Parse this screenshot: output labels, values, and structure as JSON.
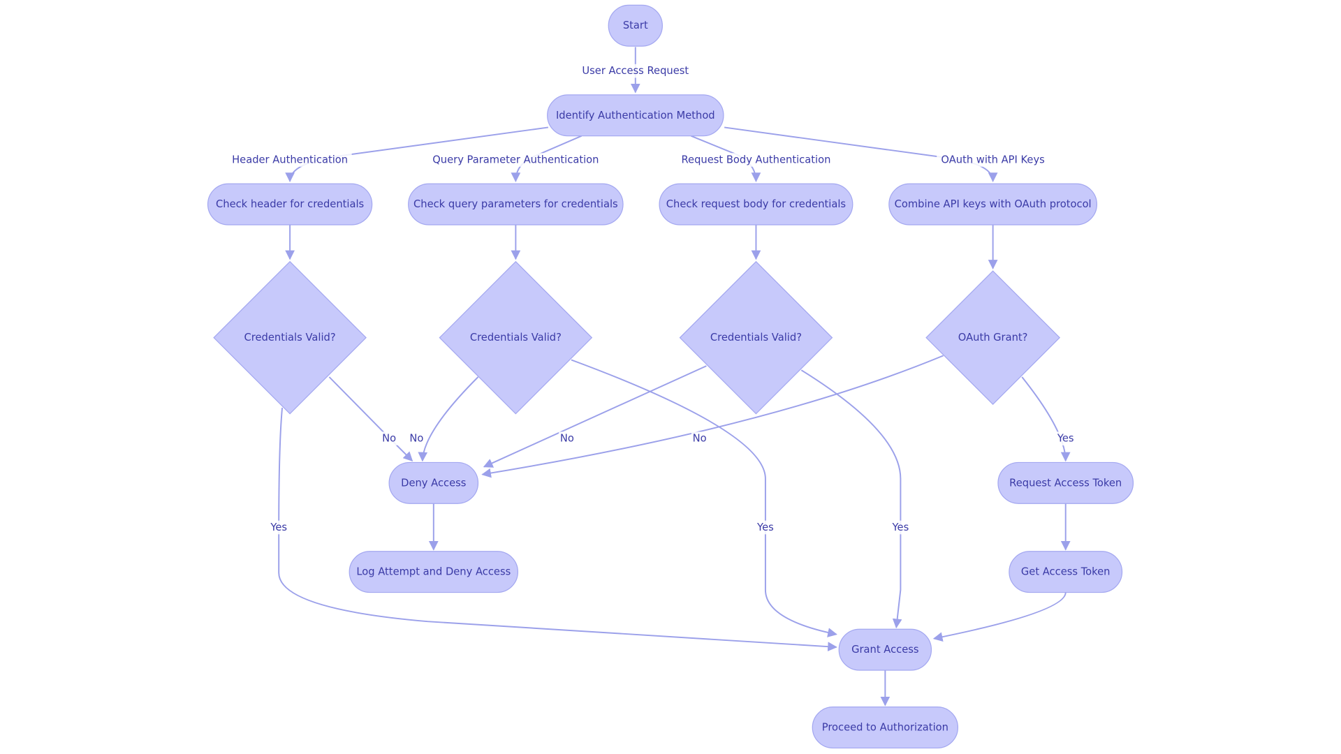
{
  "diagram": {
    "type": "flowchart",
    "colors": {
      "node_fill": "#c7c9fb",
      "node_stroke": "#a3a7f0",
      "edge": "#9ba0ea",
      "text": "#3a3aa6"
    },
    "nodes": [
      {
        "id": "start",
        "label": "Start",
        "shape": "rounded"
      },
      {
        "id": "identify",
        "label": "Identify Authentication Method",
        "shape": "rounded"
      },
      {
        "id": "check_header",
        "label": "Check header for credentials",
        "shape": "rounded"
      },
      {
        "id": "check_query",
        "label": "Check query parameters for credentials",
        "shape": "rounded"
      },
      {
        "id": "check_body",
        "label": "Check request body for credentials",
        "shape": "rounded"
      },
      {
        "id": "combine_oauth",
        "label": "Combine API keys with OAuth protocol",
        "shape": "rounded"
      },
      {
        "id": "valid_header",
        "label": "Credentials Valid?",
        "shape": "diamond"
      },
      {
        "id": "valid_query",
        "label": "Credentials Valid?",
        "shape": "diamond"
      },
      {
        "id": "valid_body",
        "label": "Credentials Valid?",
        "shape": "diamond"
      },
      {
        "id": "oauth_grant",
        "label": "OAuth Grant?",
        "shape": "diamond"
      },
      {
        "id": "deny",
        "label": "Deny Access",
        "shape": "rounded"
      },
      {
        "id": "request_token",
        "label": "Request Access Token",
        "shape": "rounded"
      },
      {
        "id": "log_deny",
        "label": "Log Attempt and Deny Access",
        "shape": "rounded"
      },
      {
        "id": "get_token",
        "label": "Get Access Token",
        "shape": "rounded"
      },
      {
        "id": "grant",
        "label": "Grant Access",
        "shape": "rounded"
      },
      {
        "id": "proceed",
        "label": "Proceed to Authorization",
        "shape": "rounded"
      }
    ],
    "edges": [
      {
        "from": "start",
        "to": "identify",
        "label": "User Access Request"
      },
      {
        "from": "identify",
        "to": "check_header",
        "label": "Header Authentication"
      },
      {
        "from": "identify",
        "to": "check_query",
        "label": "Query Parameter Authentication"
      },
      {
        "from": "identify",
        "to": "check_body",
        "label": "Request Body Authentication"
      },
      {
        "from": "identify",
        "to": "combine_oauth",
        "label": "OAuth with API Keys"
      },
      {
        "from": "check_header",
        "to": "valid_header",
        "label": ""
      },
      {
        "from": "check_query",
        "to": "valid_query",
        "label": ""
      },
      {
        "from": "check_body",
        "to": "valid_body",
        "label": ""
      },
      {
        "from": "combine_oauth",
        "to": "oauth_grant",
        "label": ""
      },
      {
        "from": "valid_header",
        "to": "deny",
        "label": "No"
      },
      {
        "from": "valid_query",
        "to": "deny",
        "label": "No"
      },
      {
        "from": "valid_body",
        "to": "deny",
        "label": "No"
      },
      {
        "from": "oauth_grant",
        "to": "deny",
        "label": "No"
      },
      {
        "from": "valid_header",
        "to": "grant",
        "label": "Yes"
      },
      {
        "from": "valid_query",
        "to": "grant",
        "label": "Yes"
      },
      {
        "from": "valid_body",
        "to": "grant",
        "label": "Yes"
      },
      {
        "from": "oauth_grant",
        "to": "request_token",
        "label": "Yes"
      },
      {
        "from": "deny",
        "to": "log_deny",
        "label": ""
      },
      {
        "from": "request_token",
        "to": "get_token",
        "label": ""
      },
      {
        "from": "get_token",
        "to": "grant",
        "label": ""
      },
      {
        "from": "grant",
        "to": "proceed",
        "label": ""
      }
    ]
  }
}
